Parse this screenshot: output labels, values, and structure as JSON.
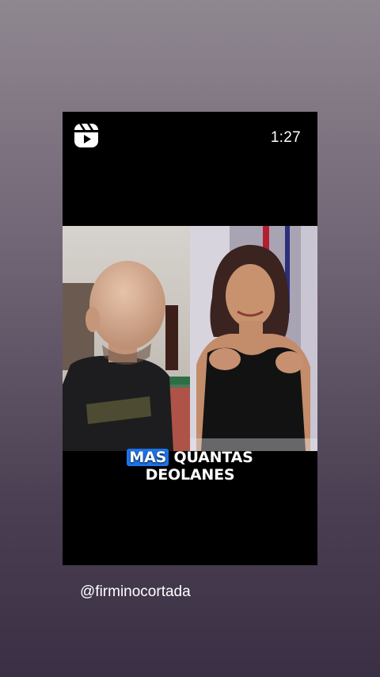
{
  "post": {
    "duration": "1:27",
    "icon": "reels-icon",
    "caption_line1": {
      "highlighted": "MAS",
      "rest": " QUANTAS"
    },
    "caption_line2": "DEOLANES",
    "mention": "@firminocortada"
  },
  "colors": {
    "card": "#000000",
    "caption_highlight": "#1e73e8",
    "text": "#ffffff"
  }
}
